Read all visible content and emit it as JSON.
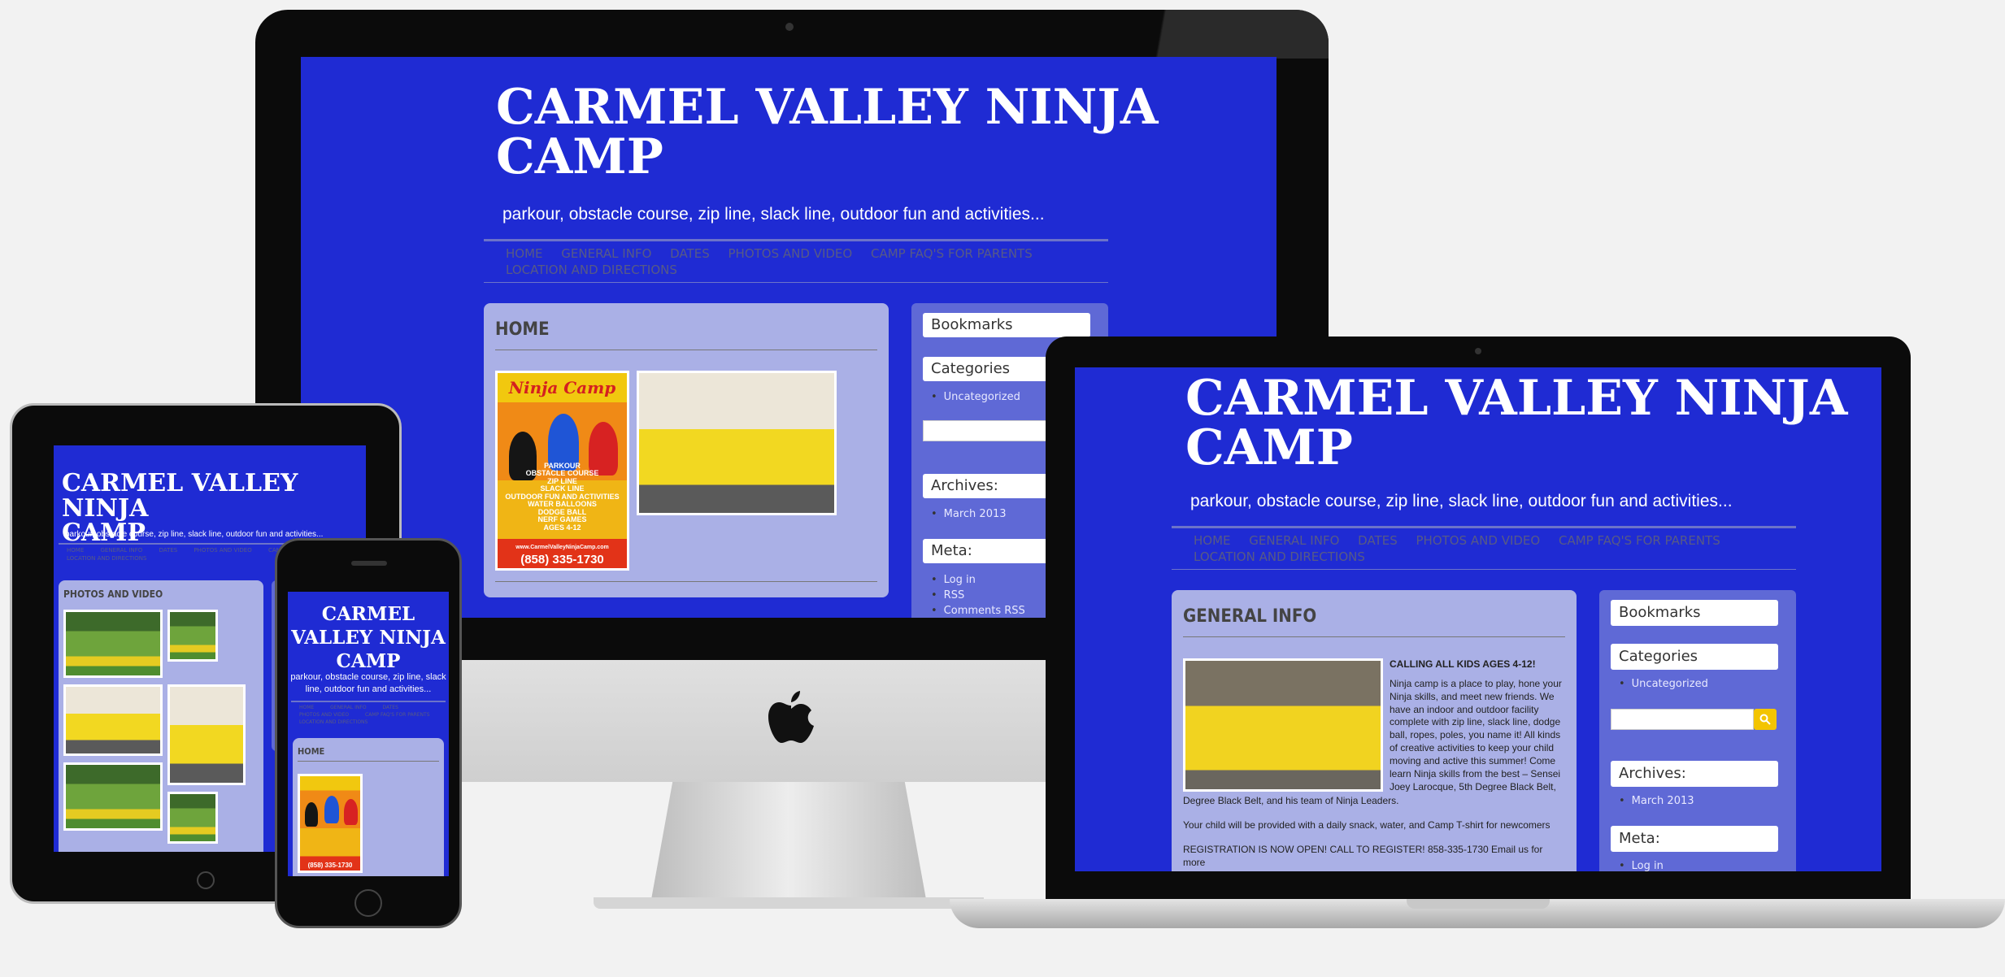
{
  "site": {
    "title": "CARMEL VALLEY NINJA CAMP",
    "title_line1": "CARMEL VALLEY NINJA",
    "title_line2": "CAMP",
    "phone_title_1": "CARMEL",
    "phone_title_2": "VALLEY NINJA",
    "phone_title_3": "CAMP",
    "tagline": "parkour, obstacle course, zip line, slack line, outdoor fun and activities...",
    "phone_tagline_1": "parkour, obstacle course, zip line, slack",
    "phone_tagline_2": "line, outdoor fun and activities..."
  },
  "nav": {
    "items": [
      "HOME",
      "GENERAL INFO",
      "DATES",
      "PHOTOS AND VIDEO",
      "CAMP FAQ'S FOR PARENTS",
      "LOCATION AND DIRECTIONS"
    ]
  },
  "pages": {
    "desktop": "HOME",
    "laptop": "GENERAL INFO",
    "tablet": "PHOTOS AND VIDEO",
    "phone": "HOME"
  },
  "sidebar": {
    "bookmarks": "Bookmarks",
    "categories": "Categories",
    "categories_items": [
      "Uncategorized"
    ],
    "archives": "Archives:",
    "archives_items": [
      "March 2013"
    ],
    "meta": "Meta:",
    "meta_items": [
      "Log in",
      "RSS",
      "Comments RSS"
    ]
  },
  "poster": {
    "title": "Ninja Camp",
    "lines": [
      "PARKOUR",
      "OBSTACLE COURSE",
      "ZIP LINE",
      "SLACK LINE",
      "OUTDOOR FUN AND ACTIVITIES",
      "WATER BALLOONS",
      "DODGE BALL",
      "NERF GAMES",
      "AGES 4-12"
    ],
    "website": "www.CarmelValleyNinjaCamp.com",
    "phone": "(858) 335-1730"
  },
  "general_info": {
    "heading": "CALLING ALL KIDS AGES 4-12!",
    "p1": "Ninja camp is a place to play, hone your Ninja skills, and meet new friends. We have an indoor and outdoor facility complete with zip line, slack line, dodge ball, ropes, poles, you name it! All kinds of creative activities to keep your child moving and active this summer! Come learn Ninja skills from the best – Sensei Joey Larocque, 5th Degree Black Belt, and his team of Ninja Leaders.",
    "p2": "Your child will be provided with a daily snack, water, and Camp T-shirt for newcomers",
    "p3": "REGISTRATION IS NOW OPEN! CALL TO REGISTER! 858-335-1730 Email us for more"
  },
  "colors": {
    "site_blue": "#1f2bd3",
    "panel": "#aab0e6",
    "sidebar": "#5f69d6",
    "search_button": "#f3c400"
  }
}
